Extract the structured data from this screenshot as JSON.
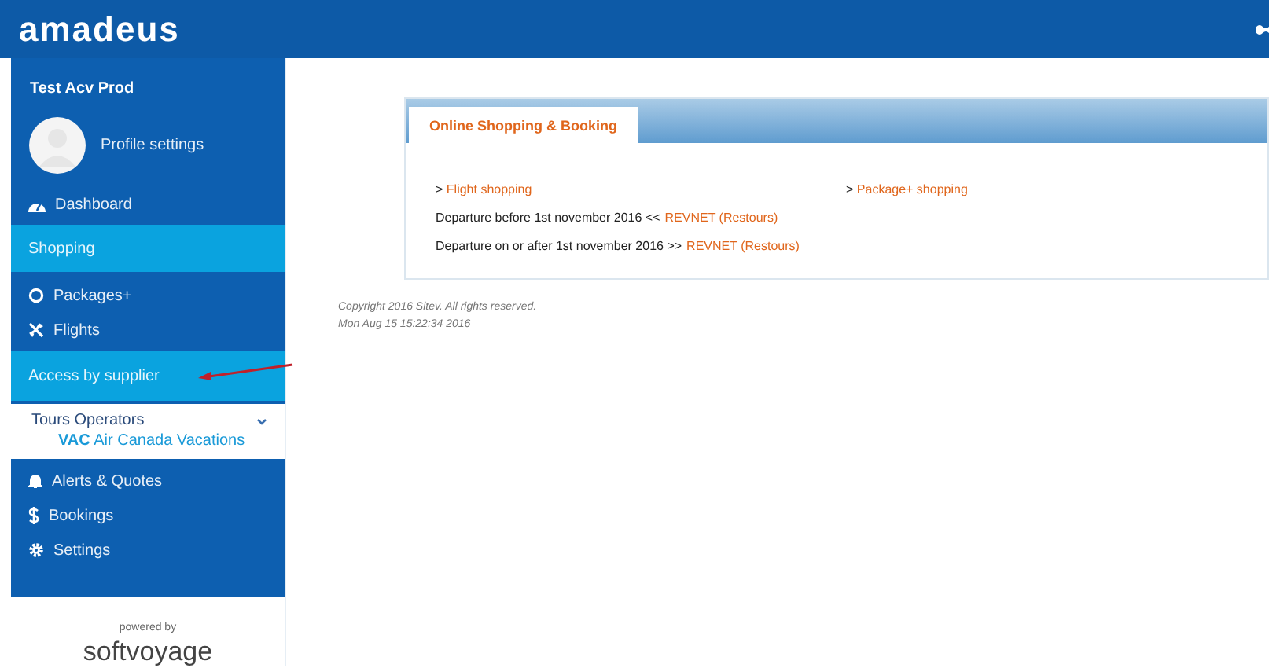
{
  "header": {
    "logo": "amadeus"
  },
  "sidebar": {
    "user_name": "Test Acv Prod",
    "profile_link": "Profile settings",
    "items": [
      {
        "kind": "link",
        "label": "Dashboard"
      },
      {
        "kind": "section",
        "label": "Shopping"
      },
      {
        "kind": "link",
        "label": "Packages+"
      },
      {
        "kind": "link",
        "label": "Flights"
      },
      {
        "kind": "section",
        "label": "Access by supplier"
      },
      {
        "kind": "group",
        "label": "Tours Operators",
        "expanded": true,
        "children": [
          {
            "code": "VAC",
            "label": "Air Canada Vacations"
          }
        ]
      },
      {
        "kind": "link",
        "label": "Alerts & Quotes"
      },
      {
        "kind": "link",
        "label": "Bookings"
      },
      {
        "kind": "link",
        "label": "Settings"
      }
    ]
  },
  "powered_by": {
    "caption": "powered by",
    "brand": "softvoyage"
  },
  "panel": {
    "tab": "Online Shopping & Booking",
    "links": [
      {
        "prefix": ">",
        "label": "Flight shopping"
      },
      {
        "prefix": ">",
        "label": "Package+ shopping"
      }
    ],
    "lines": [
      {
        "text": "Departure before 1st november 2016 <<",
        "link": "REVNET (Restours)"
      },
      {
        "text": "Departure on or after 1st november 2016 >>",
        "link": "REVNET (Restours)"
      }
    ]
  },
  "footer": {
    "copyright": "Copyright 2016 Sitev. All rights reserved.",
    "timestamp": "Mon Aug 15 15:22:34 2016"
  }
}
